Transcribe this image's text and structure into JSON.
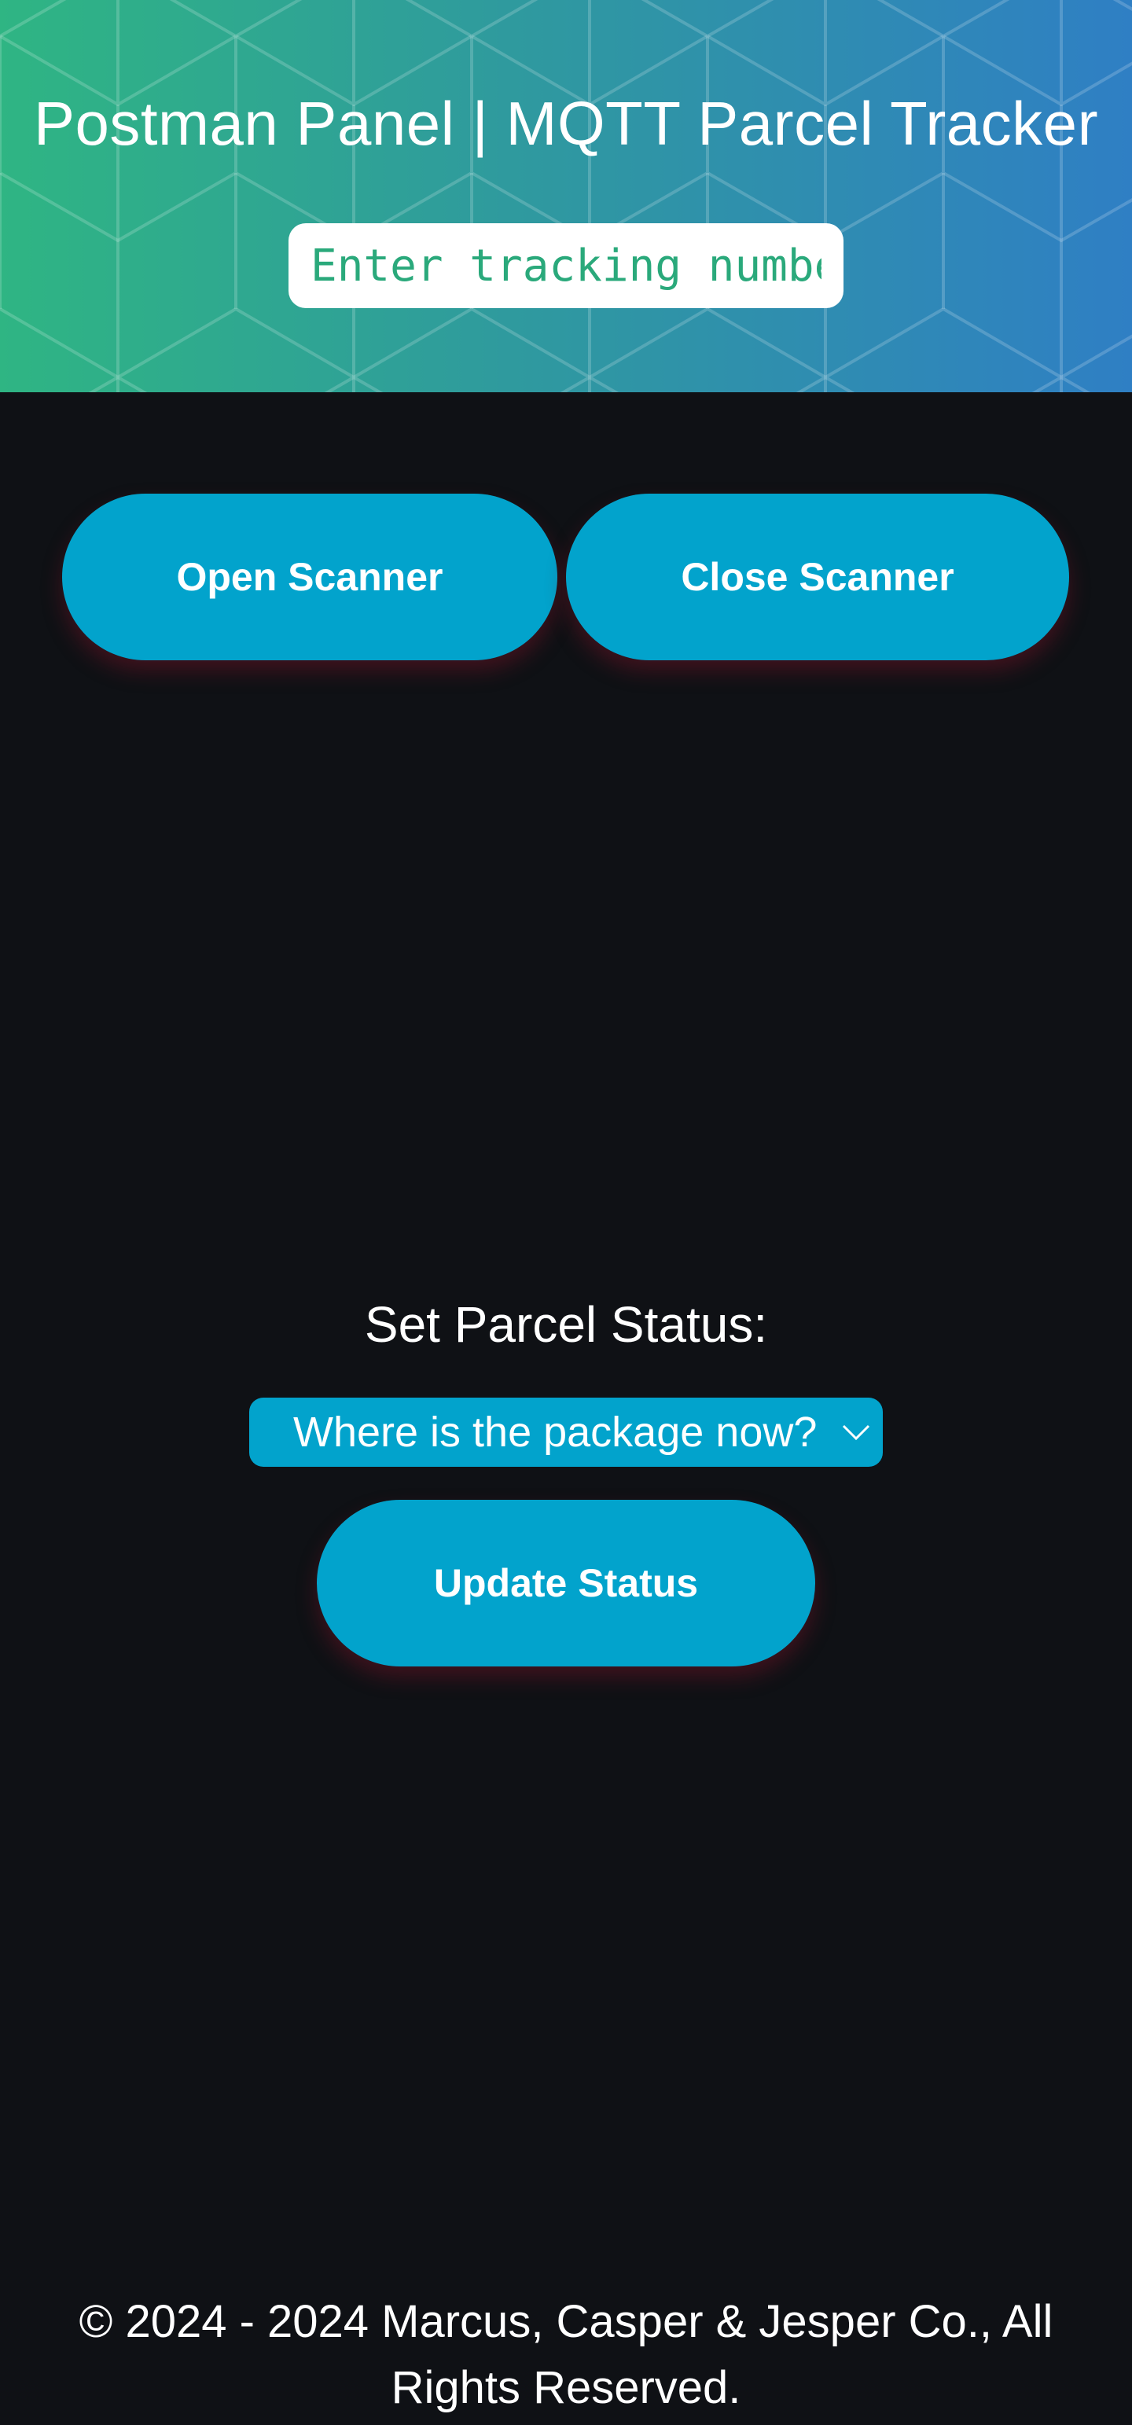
{
  "header": {
    "title": "Postman Panel | MQTT Parcel Tracker",
    "search_placeholder": "Enter tracking number"
  },
  "scanner": {
    "open_label": "Open Scanner",
    "close_label": "Close Scanner"
  },
  "status": {
    "label": "Set Parcel Status:",
    "select_value": "Where is the package now?",
    "update_label": "Update Status"
  },
  "footer": {
    "text": "© 2024 - 2024 Marcus, Casper & Jesper Co., All Rights Reserved."
  },
  "colors": {
    "background": "#0f1115",
    "accent": "#02a3cc",
    "header_gradient_start": "#2fb583",
    "header_gradient_end": "#2f7fc4",
    "input_text": "#2aa97b"
  },
  "icons": {
    "select_arrow": "chevron-down-icon"
  }
}
